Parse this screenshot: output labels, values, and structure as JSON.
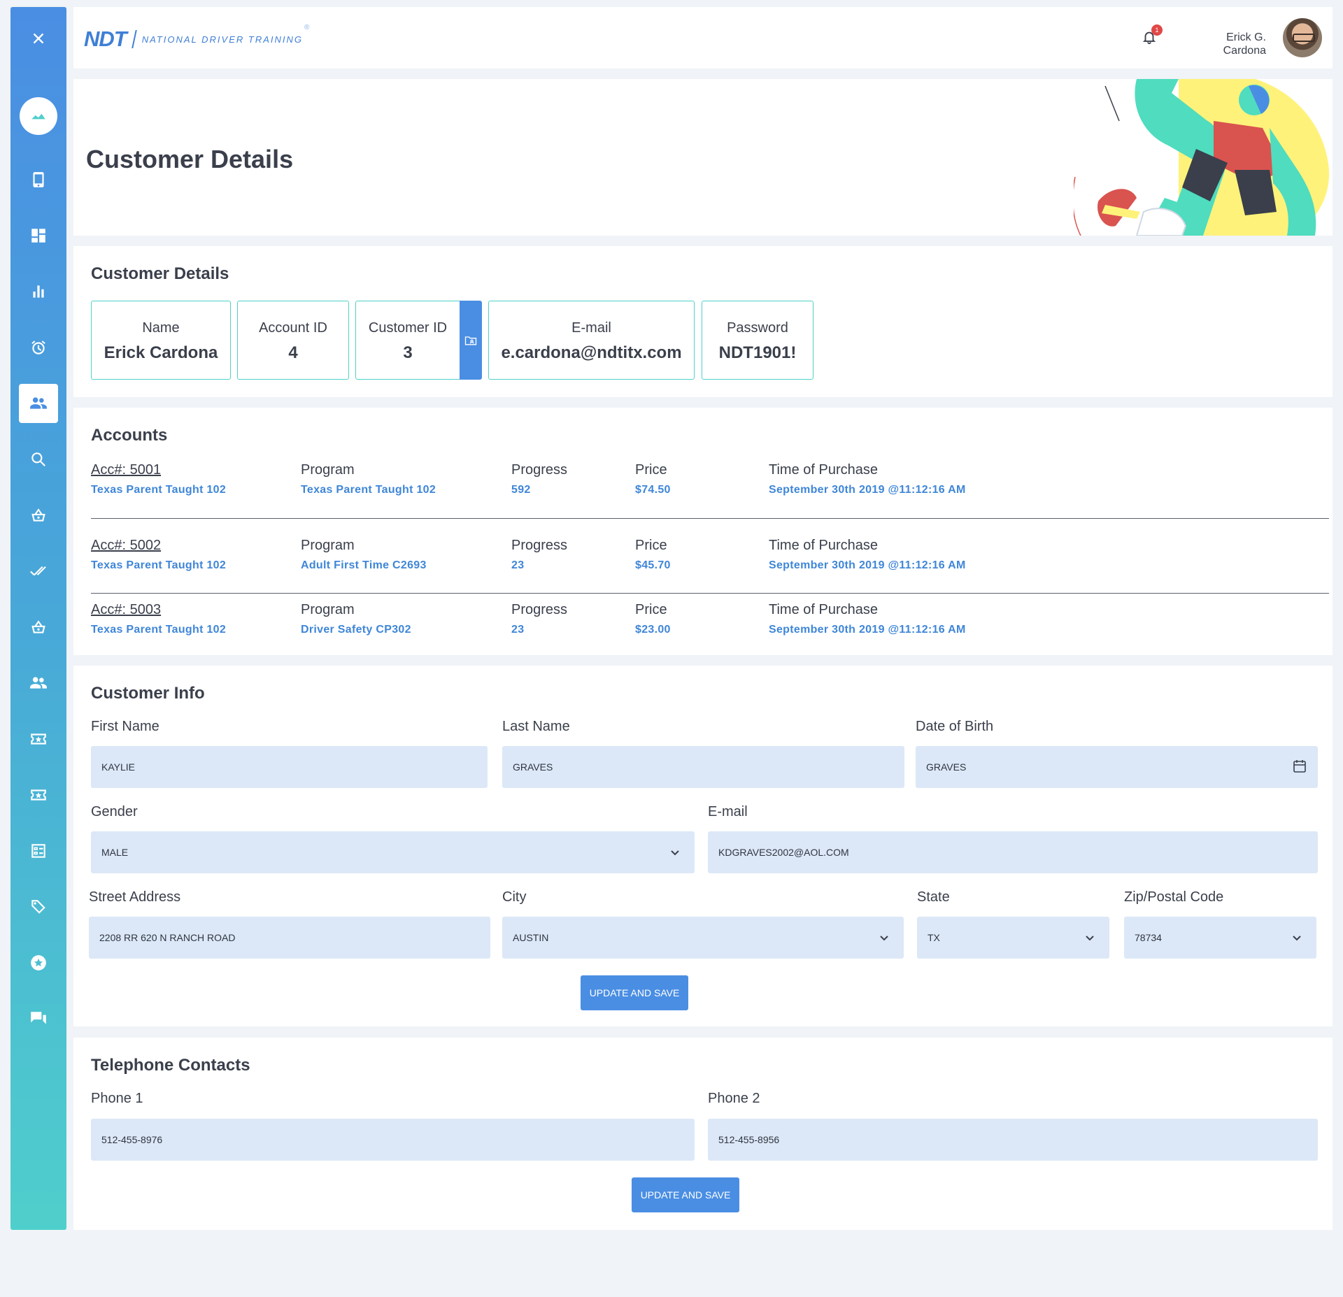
{
  "sidebar": {
    "items": [
      {
        "icon": "close-icon"
      },
      {
        "icon": "landscape-icon"
      },
      {
        "icon": "phone-icon"
      },
      {
        "icon": "dashboard-icon"
      },
      {
        "icon": "bar-chart-icon"
      },
      {
        "icon": "alarm-icon"
      },
      {
        "icon": "people-icon"
      },
      {
        "icon": "search-icon"
      },
      {
        "icon": "basket-icon"
      },
      {
        "icon": "double-check-icon"
      },
      {
        "icon": "basket-icon"
      },
      {
        "icon": "people-icon"
      },
      {
        "icon": "ticket-star-icon"
      },
      {
        "icon": "ticket-star-icon"
      },
      {
        "icon": "checklist-icon"
      },
      {
        "icon": "tag-icon"
      },
      {
        "icon": "star-badge-icon"
      },
      {
        "icon": "chat-icon"
      }
    ]
  },
  "topbar": {
    "logo_short": "NDT",
    "logo_text": "NATIONAL DRIVER TRAINING",
    "logo_reg": "®",
    "notification_count": "1",
    "user_name_line1": "Erick G.",
    "user_name_line2": "Cardona"
  },
  "hero": {
    "title": "Customer Details"
  },
  "details": {
    "title": "Customer Details",
    "name_label": "Name",
    "name_value": "Erick Cardona",
    "account_label": "Account ID",
    "account_value": "4",
    "customer_label": "Customer ID",
    "customer_value": "3",
    "email_label": "E-mail",
    "email_value": "e.cardona@ndtitx.com",
    "password_label": "Password",
    "password_value": "NDT1901!"
  },
  "accounts": {
    "title": "Accounts",
    "program_label": "Program",
    "progress_label": "Progress",
    "price_label": "Price",
    "time_label": "Time of Purchase",
    "rows": [
      {
        "acc": "Acc#: 5001",
        "acc_sub": "Texas Parent Taught 102",
        "program": "Texas Parent Taught 102",
        "progress": "592",
        "price": "$74.50",
        "time": "September 30th 2019 @11:12:16 AM"
      },
      {
        "acc": "Acc#: 5002",
        "acc_sub": "Texas Parent Taught 102",
        "program": "Adult First Time C2693",
        "progress": "23",
        "price": "$45.70",
        "time": "September 30th 2019 @11:12:16 AM"
      },
      {
        "acc": "Acc#: 5003",
        "acc_sub": "Texas Parent Taught 102",
        "program": "Driver Safety CP302",
        "progress": "23",
        "price": "$23.00",
        "time": "September 30th 2019 @11:12:16 AM"
      }
    ]
  },
  "info": {
    "title": "Customer Info",
    "first_name_label": "First Name",
    "first_name": "KAYLIE",
    "last_name_label": "Last Name",
    "last_name": "GRAVES",
    "dob_label": "Date of Birth",
    "dob": "GRAVES",
    "gender_label": "Gender",
    "gender": "MALE",
    "email_label": "E-mail",
    "email": "KDGRAVES2002@AOL.COM",
    "street_label": "Street Address",
    "street": "2208 RR 620 N RANCH ROAD",
    "city_label": "City",
    "city": "AUSTIN",
    "state_label": "State",
    "state": "TX",
    "zip_label": "Zip/Postal Code",
    "zip": "78734",
    "save_label": "UPDATE AND SAVE"
  },
  "phones": {
    "title": "Telephone Contacts",
    "phone1_label": "Phone 1",
    "phone1": "512-455-8976",
    "phone2_label": "Phone 2",
    "phone2": "512-455-8956",
    "save_label": "UPDATE AND SAVE"
  },
  "colors": {
    "accent": "#4a8ee3",
    "teal": "#4fd1c9",
    "link": "#3f86d8",
    "input_bg": "#dce8f7"
  }
}
